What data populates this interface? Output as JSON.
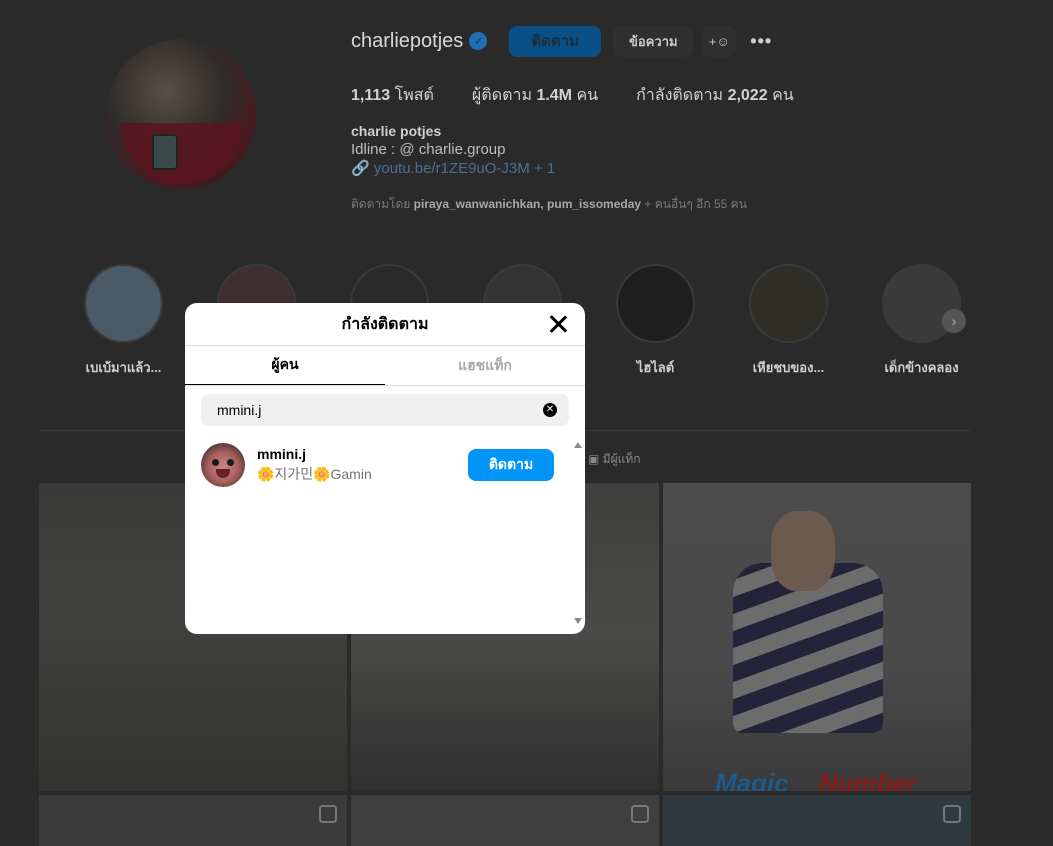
{
  "profile": {
    "username": "charliepotjes",
    "follow_label": "ติดตาม",
    "message_label": "ข้อความ",
    "posts_count": "1,113",
    "posts_label": "โพสต์",
    "followers_label": "ผู้ติดตาม",
    "followers_count": "1.4M",
    "followers_unit": "คน",
    "following_label": "กำลังติดตาม",
    "following_count": "2,022",
    "following_unit": "คน",
    "full_name": "charlie potjes",
    "bio": "Idline : @ charlie.group",
    "link": "youtu.be/r1ZE9uO-J3M + 1",
    "followed_by_prefix": "ติดตามโดย",
    "followed_by_names": "piraya_wanwanichkan, pum_issomeday",
    "followed_by_suffix": "+ คนอื่นๆ อีก 55 คน"
  },
  "highlights": [
    {
      "label": "เบเบ้มาแล้ว..."
    },
    {
      "label": ""
    },
    {
      "label": ""
    },
    {
      "label": ""
    },
    {
      "label": "ไฮไลต์"
    },
    {
      "label": "เหียชบของ..."
    },
    {
      "label": "เด็กข้างคลอง"
    }
  ],
  "tagged_tab_label": "มีผู้แท็ก",
  "grid_text": {
    "magic": "Magic",
    "number": "Number"
  },
  "modal": {
    "title": "กำลังติดตาม",
    "tab_people": "ผู้คน",
    "tab_hashtags": "แฮชแท็ก",
    "search_value": "mmini.j",
    "clear_glyph": "✕",
    "results": [
      {
        "username": "mmini.j",
        "subtitle": "🌼지가민🌼Gamin",
        "button_label": "ติดตาม"
      }
    ]
  },
  "colors": {
    "accent": "#0095f6",
    "backdrop": "#2a2a2a",
    "modal_bg": "#ffffff"
  }
}
